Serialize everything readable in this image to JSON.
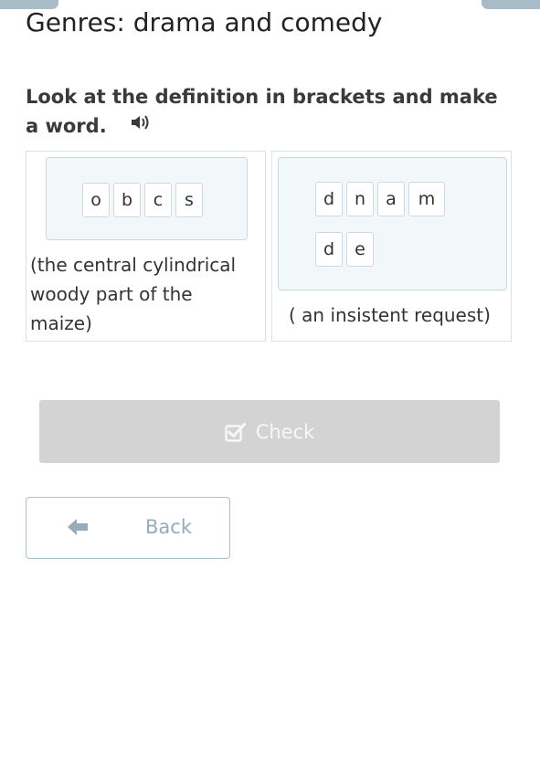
{
  "header": {
    "title": "Genres: drama and comedy"
  },
  "exercise": {
    "instruction": "Look at the definition in brackets and make a word.",
    "cards": [
      {
        "tiles": [
          "o",
          "b",
          "c",
          "s"
        ],
        "definition": "(the central cylindrical woody part of the maize)"
      },
      {
        "tiles_row1": [
          "d",
          "n",
          "a",
          "m"
        ],
        "tiles_row2": [
          "d",
          "e"
        ],
        "definition": "( an insistent request)"
      }
    ]
  },
  "actions": {
    "check_label": "Check",
    "back_label": "Back"
  },
  "colors": {
    "check_disabled_bg": "#d3d3d3",
    "back_border": "#a9c2cf",
    "dropzone_bg": "#f2f7fa"
  },
  "icons": {
    "audio": "speaker-icon",
    "check": "checkbox-icon",
    "back": "arrow-left-icon"
  }
}
